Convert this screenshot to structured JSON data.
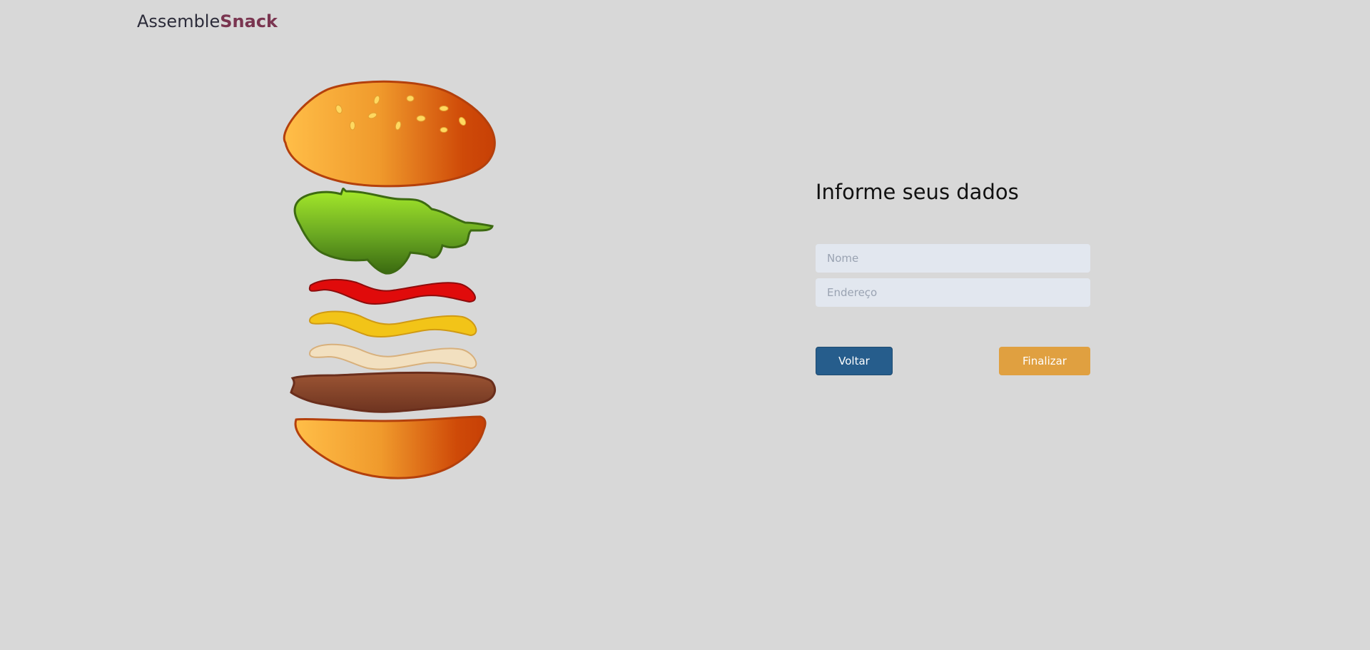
{
  "header": {
    "logo_part1": "Assemble",
    "logo_part2": "Snack"
  },
  "illustration": {
    "name": "burger-layers"
  },
  "form": {
    "title": "Informe seus dados",
    "name_placeholder": "Nome",
    "address_placeholder": "Endereço",
    "back_label": "Voltar",
    "finish_label": "Finalizar"
  },
  "colors": {
    "background": "#d8d8d8",
    "logo_accent": "#7a3550",
    "back_button": "#265d8c",
    "finish_button": "#e0a040",
    "input_bg": "#e2e7ef"
  }
}
